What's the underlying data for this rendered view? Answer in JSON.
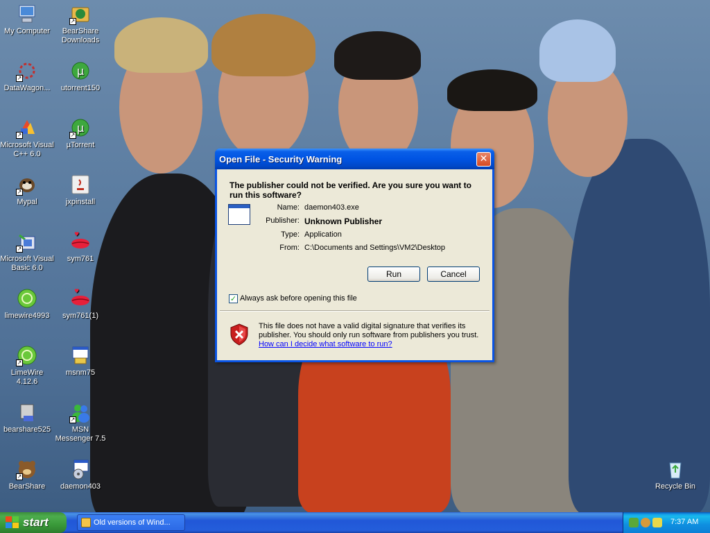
{
  "desktop": {
    "icons": [
      {
        "label": "My Computer",
        "icon": "my-computer-icon"
      },
      {
        "label": "BearShare Downloads",
        "icon": "bearshare-downloads-icon"
      },
      {
        "label": "DataWagon...",
        "icon": "datawagon-icon"
      },
      {
        "label": "utorrent150",
        "icon": "utorrent-icon"
      },
      {
        "label": "Microsoft Visual C++ 6.0",
        "icon": "visual-cpp-icon"
      },
      {
        "label": "µTorrent",
        "icon": "utorrent-shortcut-icon"
      },
      {
        "label": "Mypal",
        "icon": "mypal-icon"
      },
      {
        "label": "jxpinstall",
        "icon": "java-installer-icon"
      },
      {
        "label": "Microsoft Visual Basic 6.0",
        "icon": "visual-basic-icon"
      },
      {
        "label": "sym761",
        "icon": "lips-icon"
      },
      {
        "label": "limewire4993",
        "icon": "limewire-icon"
      },
      {
        "label": "sym761(1)",
        "icon": "lips-icon"
      },
      {
        "label": "LimeWire 4.12.6",
        "icon": "limewire-shortcut-icon"
      },
      {
        "label": "msnm75",
        "icon": "installer-icon"
      },
      {
        "label": "bearshare525",
        "icon": "bearshare-installer-icon"
      },
      {
        "label": "MSN Messenger 7.5",
        "icon": "msn-messenger-icon"
      },
      {
        "label": "BearShare",
        "icon": "bearshare-icon"
      },
      {
        "label": "daemon403",
        "icon": "daemon-installer-icon"
      },
      {
        "label": "Recycle Bin",
        "icon": "recycle-bin-icon"
      }
    ]
  },
  "dialog": {
    "title": "Open File - Security Warning",
    "question": "The publisher could not be verified.  Are you sure you want to run this software?",
    "fields": [
      {
        "key": "Name:",
        "value": "daemon403.exe"
      },
      {
        "key": "Publisher:",
        "value": "Unknown Publisher"
      },
      {
        "key": "Type:",
        "value": "Application"
      },
      {
        "key": "From:",
        "value": "C:\\Documents and Settings\\VM2\\Desktop"
      }
    ],
    "run_label": "Run",
    "cancel_label": "Cancel",
    "checkbox_label": "Always ask before opening this file",
    "checkbox_checked": true,
    "warning_text": "This file does not have a valid digital signature that verifies its publisher.  You should only run software from publishers you trust.",
    "help_link": "How can I decide what software to run?"
  },
  "taskbar": {
    "start_label": "start",
    "task_item": "Old versions of Wind...",
    "clock": "7:37 AM"
  },
  "colors": {
    "titlebar": "#0054e3",
    "dialog_bg": "#ece9d8",
    "taskbar": "#245edb",
    "start": "#3a9a3a",
    "link": "#0000ff"
  }
}
